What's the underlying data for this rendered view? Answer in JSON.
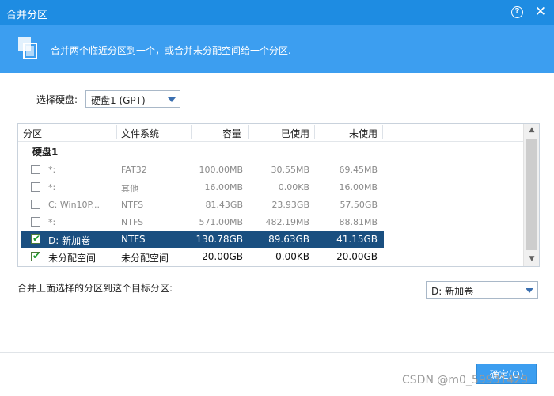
{
  "window": {
    "title": "合并分区",
    "help_glyph": "?",
    "close_glyph": "✕"
  },
  "banner": {
    "text": "合并两个临近分区到一个，或合并未分配空间给一个分区."
  },
  "disk_select": {
    "label": "选择硬盘:",
    "value": "硬盘1 (GPT)"
  },
  "table": {
    "columns": [
      "分区",
      "文件系统",
      "容量",
      "已使用",
      "未使用"
    ],
    "disk_header": "硬盘1",
    "rows": [
      {
        "partition": "*:",
        "fs": "FAT32",
        "capacity": "100.00MB",
        "used": "30.55MB",
        "unused": "69.45MB",
        "checked": false,
        "state": "dim"
      },
      {
        "partition": "*:",
        "fs": "其他",
        "capacity": "16.00MB",
        "used": "0.00KB",
        "unused": "16.00MB",
        "checked": false,
        "state": "dim"
      },
      {
        "partition": "C:  Win10P...",
        "fs": "NTFS",
        "capacity": "81.43GB",
        "used": "23.93GB",
        "unused": "57.50GB",
        "checked": false,
        "state": "dim"
      },
      {
        "partition": "*:",
        "fs": "NTFS",
        "capacity": "571.00MB",
        "used": "482.19MB",
        "unused": "88.81MB",
        "checked": false,
        "state": "dim"
      },
      {
        "partition": "D:  新加卷",
        "fs": "NTFS",
        "capacity": "130.78GB",
        "used": "89.63GB",
        "unused": "41.15GB",
        "checked": true,
        "state": "selected"
      },
      {
        "partition": "未分配空间",
        "fs": "未分配空间",
        "capacity": "20.00GB",
        "used": "0.00KB",
        "unused": "20.00GB",
        "checked": true,
        "state": "active"
      }
    ],
    "scroll_up": "▲",
    "scroll_down": "▼"
  },
  "target": {
    "label": "合并上面选择的分区到这个目标分区:",
    "value": "D:  新加卷"
  },
  "footer": {
    "ok_label": "确定(O)",
    "watermark": "CSDN @m0_59931429"
  },
  "colors": {
    "titlebar": "#1e8ce2",
    "banner": "#3c9ef0",
    "selected_row": "#1a4f80",
    "check": "#1d9a2a"
  }
}
